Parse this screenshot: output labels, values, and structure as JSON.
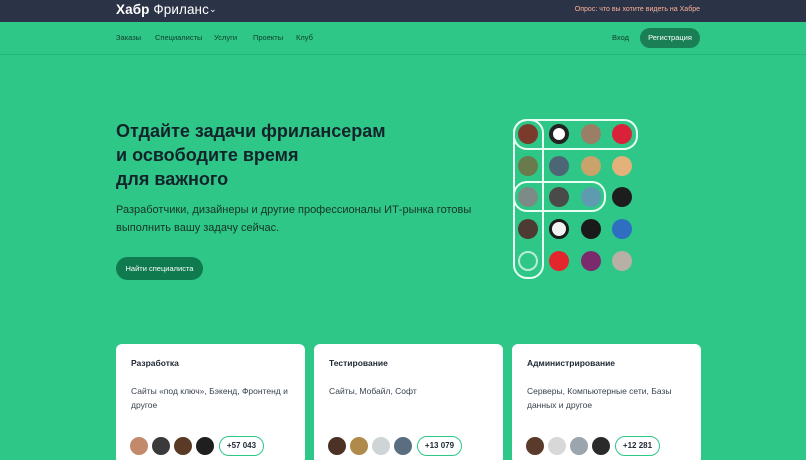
{
  "topbar": {
    "brand_bold": "Хабр",
    "brand_light": "Фриланс",
    "survey": "Опрос: что вы хотите видеть на Хабре"
  },
  "nav": {
    "items": [
      "Заказы",
      "Специалисты",
      "Услуги",
      "Проекты",
      "Клуб"
    ],
    "login": "Вход",
    "register": "Регистрация"
  },
  "hero": {
    "title_lines": [
      "Отдайте задачи фрилансерам",
      "и освободите время",
      "для важного"
    ],
    "subtitle_lines": [
      "Разработчики, дизайнеры и другие профессионалы ИТ-рынка готовы",
      "выполнить вашу задачу сейчас."
    ],
    "cta": "Найти специалиста"
  },
  "cards": [
    {
      "title": "Разработка",
      "desc_lines": [
        "Сайты «под ключ», Бэкенд, Фронтенд и",
        "другое"
      ],
      "count": "+57 043"
    },
    {
      "title": "Тестирование",
      "desc_lines": [
        "Сайты, Мобайл, Софт"
      ],
      "count": "+13 079"
    },
    {
      "title": "Администрирование",
      "desc_lines": [
        "Серверы, Компьютерные сети, Базы",
        "данных и другое"
      ],
      "count": "+12 281"
    }
  ],
  "colors": {
    "accent": "#2fc788",
    "topbar": "#2b3446",
    "button_dark": "#0f7a4e"
  }
}
